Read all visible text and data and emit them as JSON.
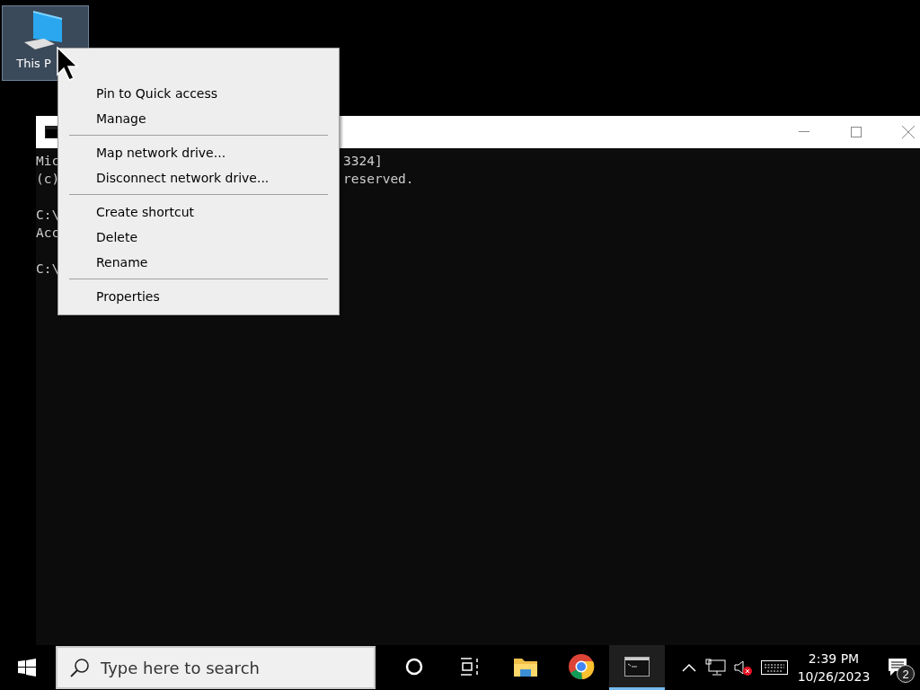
{
  "desktop_icons": [
    {
      "label": "This P",
      "selected": true
    }
  ],
  "console": {
    "blocks": [
      [
        {
          "left": "Mic",
          "right": "3324]"
        },
        {
          "left": "(c)",
          "right": "reserved."
        }
      ],
      [
        {
          "left": "C:\\"
        },
        {
          "left": "Acc"
        }
      ],
      [
        {
          "left": "C:\\"
        }
      ]
    ]
  },
  "context_menu": {
    "groups": [
      [
        "Pin to Quick access",
        "Manage"
      ],
      [
        "Map network drive...",
        "Disconnect network drive..."
      ],
      [
        "Create shortcut",
        "Delete",
        "Rename"
      ],
      [
        "Properties"
      ]
    ]
  },
  "taskbar": {
    "search": {
      "placeholder": "Type here to search"
    },
    "apps": [
      {
        "kind": "cortana",
        "active": false
      },
      {
        "kind": "taskview",
        "active": false
      },
      {
        "kind": "explorer",
        "active": false
      },
      {
        "kind": "chrome",
        "active": false
      },
      {
        "kind": "terminal",
        "active": true
      }
    ],
    "clock": {
      "time": "2:39 PM",
      "date": "10/26/2023"
    },
    "notifications": "2"
  }
}
